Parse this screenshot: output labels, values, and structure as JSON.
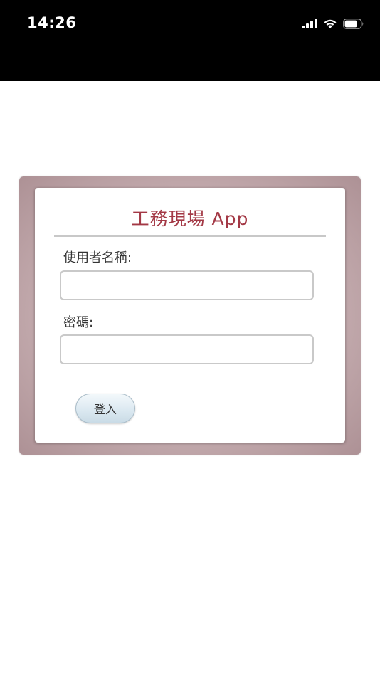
{
  "status_bar": {
    "time": "14:26"
  },
  "login": {
    "title": "工務現場  App",
    "username_label": "使用者名稱:",
    "username_value": "",
    "password_label": "密碼:",
    "password_value": "",
    "login_button_label": "登入"
  },
  "colors": {
    "title": "#a33845",
    "frame": "#c6aeb1",
    "button": "#dce9f1"
  },
  "icons": [
    "signal-icon",
    "wifi-icon",
    "battery-icon"
  ]
}
